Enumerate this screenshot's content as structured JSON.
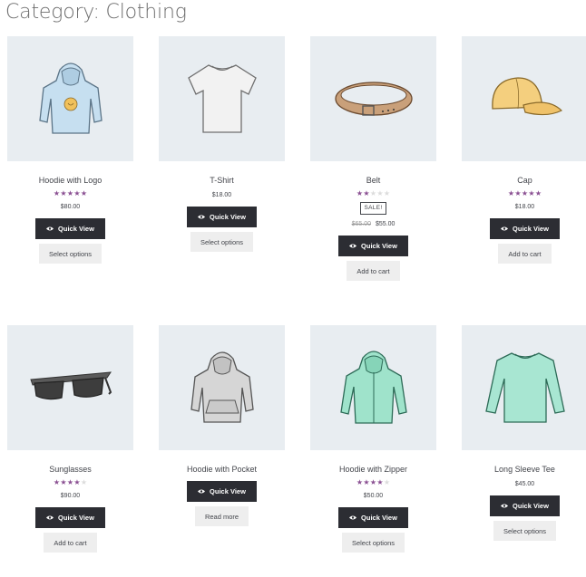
{
  "page": {
    "title": "Category: Clothing"
  },
  "common": {
    "quick_view_label": "Quick View"
  },
  "products": [
    {
      "name": "Hoodie with Logo",
      "rating": 5,
      "price": "$80.00",
      "action": "Select options"
    },
    {
      "name": "T-Shirt",
      "price": "$18.00",
      "action": "Select options"
    },
    {
      "name": "Belt",
      "rating": 2,
      "sale_badge": "SALE!",
      "old_price": "$65.00",
      "price": "$55.00",
      "action": "Add to cart"
    },
    {
      "name": "Cap",
      "rating": 5,
      "price": "$18.00",
      "action": "Add to cart"
    },
    {
      "name": "Sunglasses",
      "rating": 4,
      "price": "$90.00",
      "action": "Add to cart"
    },
    {
      "name": "Hoodie with Pocket",
      "action": "Read more"
    },
    {
      "name": "Hoodie with Zipper",
      "rating": 4,
      "price": "$50.00",
      "action": "Select options"
    },
    {
      "name": "Long Sleeve Tee",
      "price": "$45.00",
      "action": "Select options"
    }
  ],
  "icons": {
    "quick_view": "eye-icon",
    "rating": "star-icon",
    "images": [
      "hoodie-logo-image",
      "tshirt-image",
      "belt-image",
      "cap-image",
      "sunglasses-image",
      "hoodie-pocket-image",
      "hoodie-zipper-image",
      "long-sleeve-tee-image"
    ]
  },
  "colors": {
    "star_filled": "#8a4f92",
    "star_empty": "#dcdcdc",
    "quick_view_bg": "#2c2d33",
    "secondary_button_bg": "#eeeeee",
    "thumb_bg": "#e8edf1"
  }
}
